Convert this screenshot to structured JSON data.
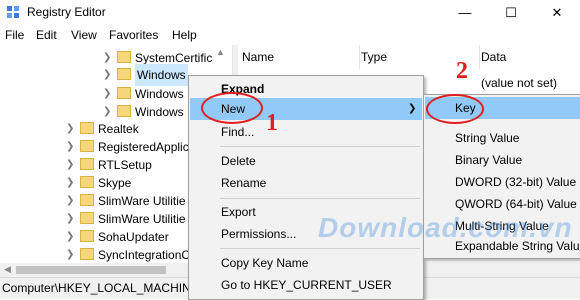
{
  "window": {
    "title": "Registry Editor"
  },
  "window_controls": {
    "minimize": "—",
    "maximize": "☐",
    "close": "✕"
  },
  "menu": [
    "File",
    "Edit",
    "View",
    "Favorites",
    "Help"
  ],
  "tree": {
    "items": [
      {
        "label": "SystemCertific"
      },
      {
        "label": "Windows",
        "selected": true
      },
      {
        "label": "Windows"
      },
      {
        "label": "Windows"
      },
      {
        "label": "Realtek"
      },
      {
        "label": "RegisteredApplic"
      },
      {
        "label": "RTLSetup"
      },
      {
        "label": "Skype"
      },
      {
        "label": "SlimWare Utilitie"
      },
      {
        "label": "SlimWare Utilitie"
      },
      {
        "label": "SohaUpdater"
      },
      {
        "label": "SyncIntegrationC"
      }
    ]
  },
  "values_pane": {
    "columns": [
      "Name",
      "Type",
      "Data"
    ],
    "rows": [
      {
        "data": "(value not set)"
      }
    ]
  },
  "statusbar": {
    "path": "Computer\\HKEY_LOCAL_MACHIN"
  },
  "context_menu": {
    "items": [
      "Expand",
      "New",
      "Find...",
      "Delete",
      "Rename",
      "Export",
      "Permissions...",
      "Copy Key Name",
      "Go to HKEY_CURRENT_USER"
    ]
  },
  "submenu": {
    "items": [
      "Key",
      "String Value",
      "Binary Value",
      "DWORD (32-bit) Value",
      "QWORD (64-bit) Value",
      "Multi-String Value",
      "Expandable String Value"
    ]
  },
  "annotations": {
    "step1": "1",
    "step2": "2"
  },
  "watermark": "Download.com.vn",
  "colors": {
    "highlight": "#91c9f7",
    "annotation": "#e02020",
    "selection": "#cce8ff"
  }
}
